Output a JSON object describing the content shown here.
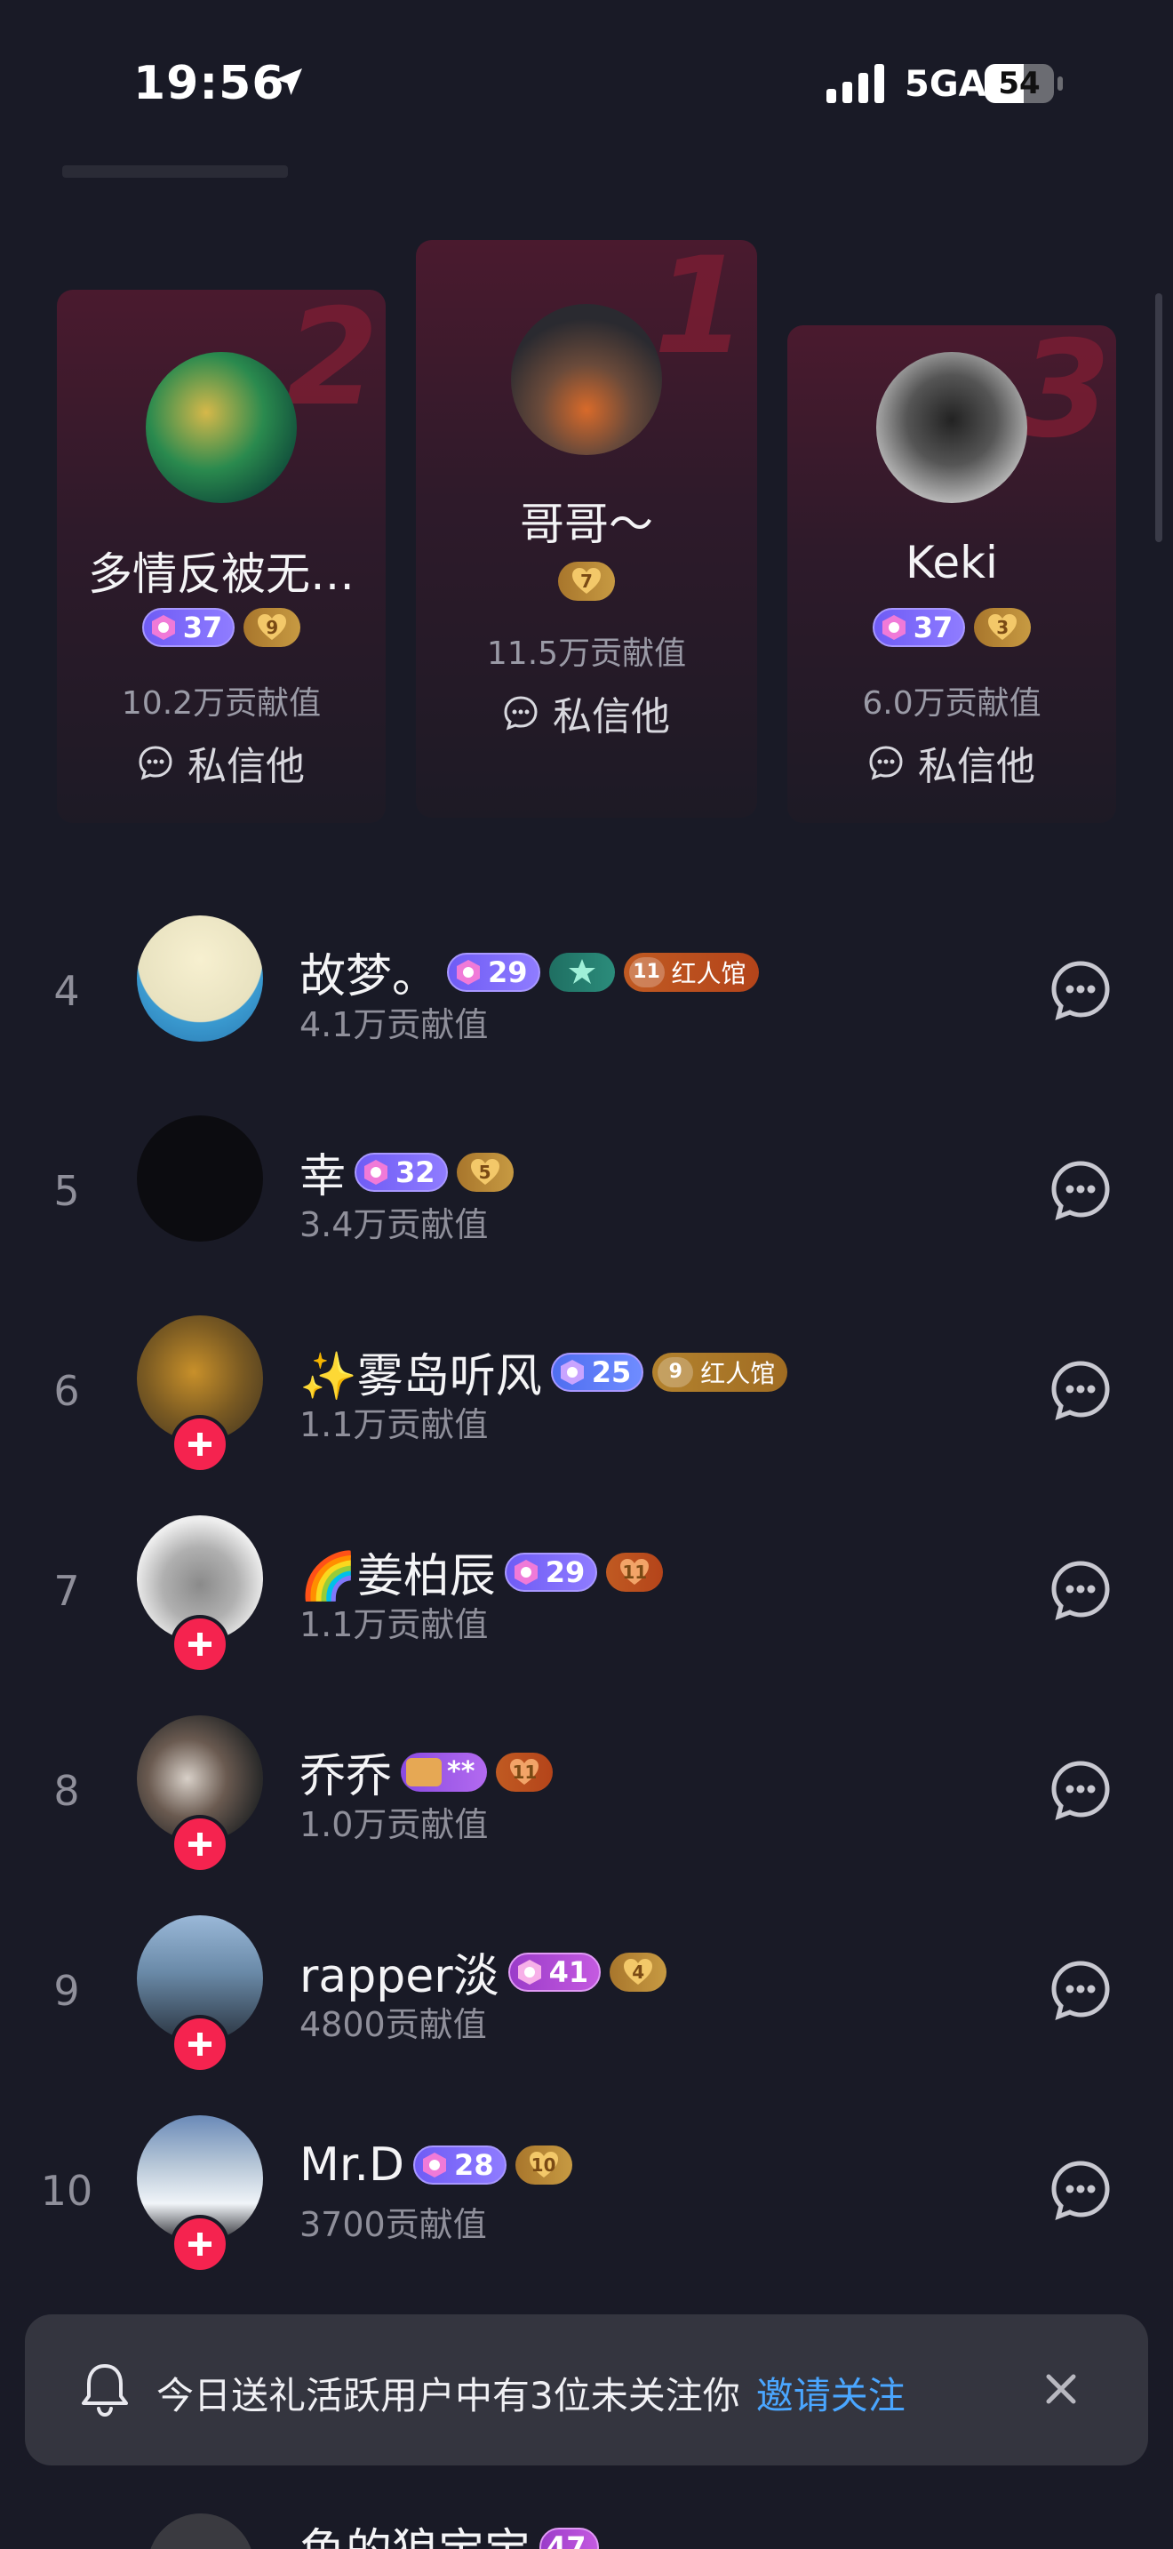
{
  "status_bar": {
    "time": "19:56",
    "network": "5GA",
    "battery": "54"
  },
  "podium": [
    {
      "rank": "2",
      "name": "多情反被无…",
      "level": "37",
      "heart": "9",
      "value": "10.2万贡献值",
      "message": "私信他"
    },
    {
      "rank": "1",
      "name": "哥哥～",
      "heart": "7",
      "value": "11.5万贡献值",
      "message": "私信他"
    },
    {
      "rank": "3",
      "name": "Keki",
      "level": "37",
      "heart": "3",
      "value": "6.0万贡献值",
      "message": "私信他"
    }
  ],
  "rows": [
    {
      "rank": "4",
      "name": "故梦。",
      "level": "29",
      "hall_num": "11",
      "hall_label": "红人馆",
      "value": "4.1万贡献值"
    },
    {
      "rank": "5",
      "name": "幸",
      "level": "32",
      "heart": "5",
      "value": "3.4万贡献值"
    },
    {
      "rank": "6",
      "name": "✨雾岛听风",
      "level": "25",
      "hall_num": "9",
      "hall_label": "红人馆",
      "value": "1.1万贡献值"
    },
    {
      "rank": "7",
      "name": "🌈姜柏辰",
      "level": "29",
      "heart": "11",
      "value": "1.1万贡献值"
    },
    {
      "rank": "8",
      "name": "乔乔",
      "vip": "**",
      "heart": "11",
      "value": "1.0万贡献值"
    },
    {
      "rank": "9",
      "name": "rapper淡",
      "level": "41",
      "heart": "4",
      "value": "4800贡献值"
    },
    {
      "rank": "10",
      "name": "Mr.D",
      "level": "28",
      "heart": "10",
      "value": "3700贡献值"
    }
  ],
  "partial_row": {
    "name": "鱼的狼宝宝",
    "level": "47"
  },
  "toast": {
    "text": "今日送礼活跃用户中有3位未关注你",
    "link": "邀请关注"
  },
  "colors": {
    "background": "#191a26",
    "accent_red": "#f5234f",
    "link_blue": "#4aa6ff"
  }
}
